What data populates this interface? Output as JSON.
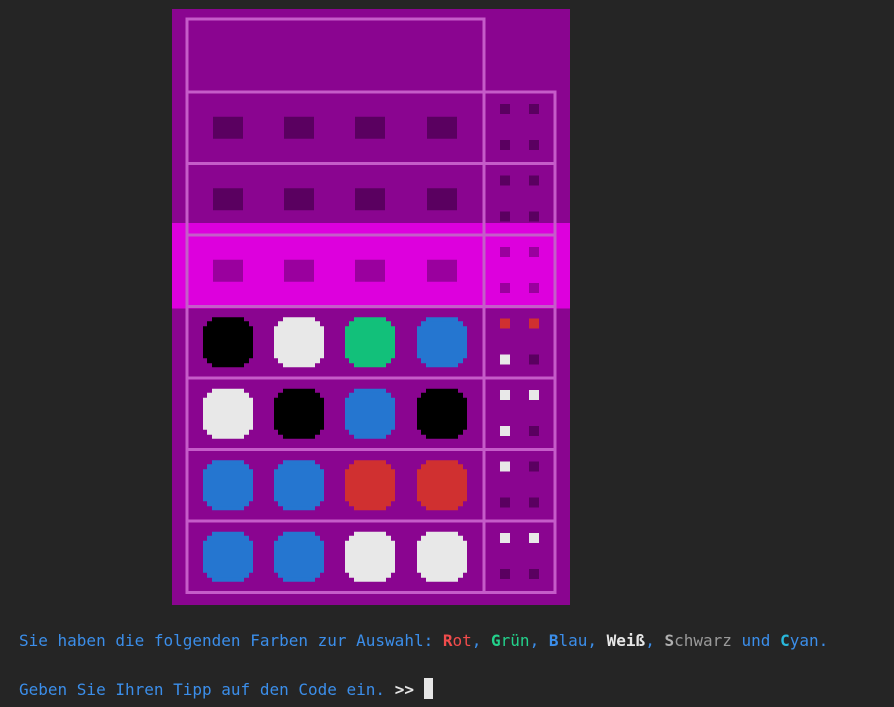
{
  "board": {
    "colors": {
      "board_bg": "#8a0590",
      "highlight_bg": "#dd00dd",
      "frame": "#c55cc9",
      "empty_hole": "#5a0060",
      "empty_hole_active": "#9a009e",
      "empty_peg": "#5a0060",
      "empty_peg_active": "#9a009e"
    },
    "secret_row": "hidden",
    "active_row_index": 2,
    "peg_colors": {
      "schwarz": "#000000",
      "weiss": "#e8e8e8",
      "gruen": "#12c07a",
      "blau": "#2576d0",
      "rot": "#d03030"
    },
    "rows": [
      {
        "guess": [
          null,
          null,
          null,
          null
        ],
        "feedback": [
          null,
          null,
          null,
          null
        ]
      },
      {
        "guess": [
          null,
          null,
          null,
          null
        ],
        "feedback": [
          null,
          null,
          null,
          null
        ]
      },
      {
        "guess": [
          null,
          null,
          null,
          null
        ],
        "feedback": [
          null,
          null,
          null,
          null
        ]
      },
      {
        "guess": [
          "schwarz",
          "weiss",
          "gruen",
          "blau"
        ],
        "feedback": [
          "rot",
          "rot",
          "weiss",
          null
        ]
      },
      {
        "guess": [
          "weiss",
          "schwarz",
          "blau",
          "schwarz"
        ],
        "feedback": [
          "weiss",
          "weiss",
          "weiss",
          null
        ]
      },
      {
        "guess": [
          "blau",
          "blau",
          "rot",
          "rot"
        ],
        "feedback": [
          "weiss",
          null,
          null,
          null
        ]
      },
      {
        "guess": [
          "blau",
          "blau",
          "weiss",
          "weiss"
        ],
        "feedback": [
          "weiss",
          "weiss",
          null,
          null
        ]
      }
    ]
  },
  "terminal": {
    "line1": {
      "prefix": "Sie haben die folgenden Farben zur Auswahl: ",
      "options": [
        {
          "initial": "R",
          "rest": "ot",
          "initial_color": "#f14c4c",
          "rest_color": "#f14c4c",
          "sep": ", "
        },
        {
          "initial": "G",
          "rest": "rün",
          "initial_color": "#23d18b",
          "rest_color": "#23d18b",
          "sep": ", "
        },
        {
          "initial": "B",
          "rest": "lau",
          "initial_color": "#3b8eea",
          "rest_color": "#3b8eea",
          "sep": ", "
        },
        {
          "initial": "W",
          "rest": "eiß",
          "initial_color": "#e6e6e6",
          "rest_color": "#e6e6e6",
          "sep": ", "
        },
        {
          "initial": "S",
          "rest": "chwarz",
          "initial_color": "#b0b0b0",
          "rest_color": "#9a9a9a",
          "sep": " und "
        },
        {
          "initial": "C",
          "rest": "yan",
          "initial_color": "#29b8db",
          "rest_color": "#3b8eea",
          "sep": "."
        }
      ]
    },
    "line2": {
      "prompt_text": "Geben Sie Ihren Tipp auf den Code ein. ",
      "prompt_marker": ">>"
    }
  }
}
